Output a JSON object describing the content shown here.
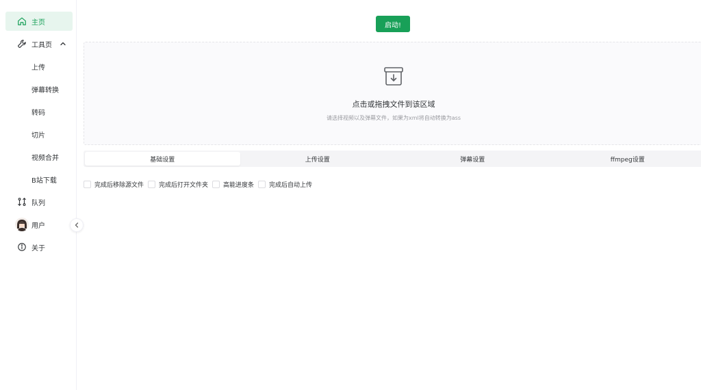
{
  "sidebar": {
    "items": [
      {
        "label": "主页",
        "icon": "home-icon",
        "active": true
      },
      {
        "label": "工具页",
        "icon": "wrench-icon",
        "expanded": true
      },
      {
        "label": "队列",
        "icon": "queue-icon"
      },
      {
        "label": "用户",
        "icon": "avatar"
      },
      {
        "label": "关于",
        "icon": "info-icon"
      }
    ],
    "tools_sub": [
      "上传",
      "弹幕转换",
      "转码",
      "切片",
      "视频合并",
      "B站下载"
    ]
  },
  "toolbar": {
    "start_label": "启动!"
  },
  "dropzone": {
    "title": "点击或拖拽文件到该区域",
    "hint": "请选择视频以及弹幕文件，如果为xml将自动转换为ass"
  },
  "tabs": [
    {
      "label": "基础设置",
      "active": true
    },
    {
      "label": "上传设置"
    },
    {
      "label": "弹幕设置"
    },
    {
      "label": "ffmpeg设置"
    }
  ],
  "options": [
    {
      "label": "完成后移除源文件",
      "checked": false
    },
    {
      "label": "完成后打开文件夹",
      "checked": false
    },
    {
      "label": "高能进度条",
      "checked": false
    },
    {
      "label": "完成后自动上传",
      "checked": false
    }
  ],
  "colors": {
    "accent": "#18a058",
    "active_bg": "#e7f5ee"
  }
}
